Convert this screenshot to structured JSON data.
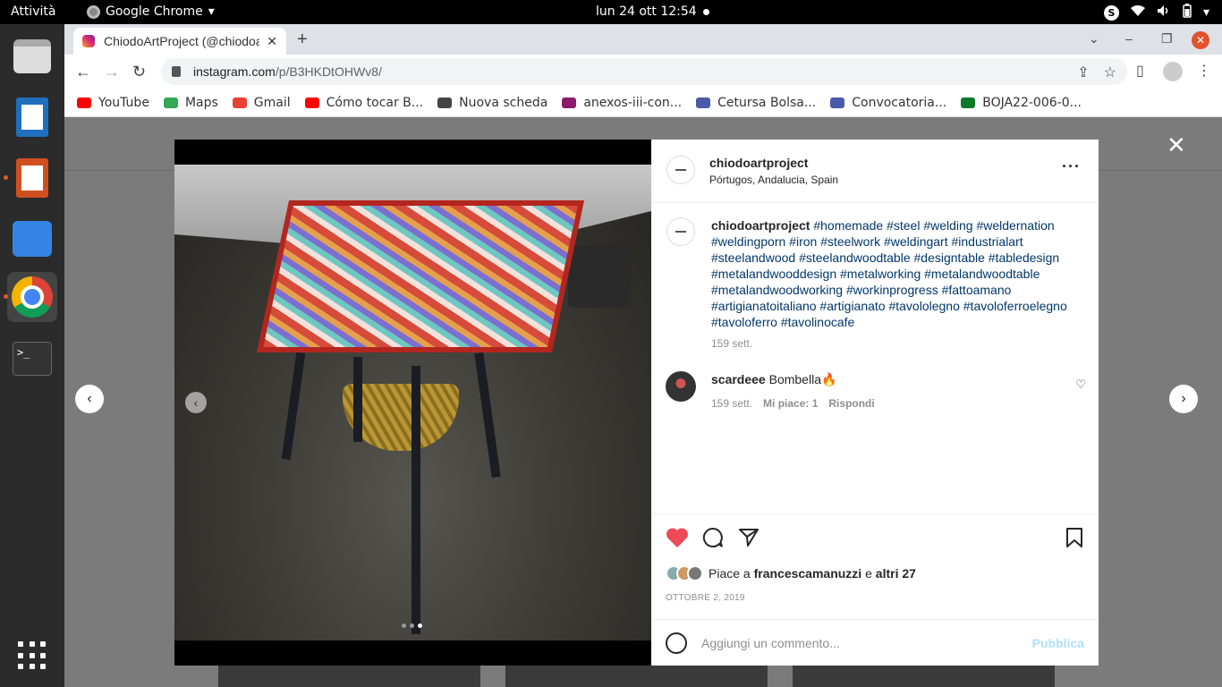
{
  "topbar": {
    "activities": "Attività",
    "app_name": "Google Chrome",
    "clock": "lun 24 ott  12:54"
  },
  "browser": {
    "tab_title": "ChiodoArtProject (@chiodoartproject)",
    "url_host": "instagram.com",
    "url_path": "/p/B3HKDtOHWv8/",
    "bookmarks": [
      {
        "label": "YouTube",
        "color": "#ff0000"
      },
      {
        "label": "Maps",
        "color": "#34a853"
      },
      {
        "label": "Gmail",
        "color": "#ea4335"
      },
      {
        "label": "Cómo tocar B...",
        "color": "#ff0000"
      },
      {
        "label": "Nuova scheda",
        "color": "#444444"
      },
      {
        "label": "anexos-iii-con...",
        "color": "#8b1a6b"
      },
      {
        "label": "Cetursa Bolsa...",
        "color": "#4a5aa8"
      },
      {
        "label": "Convocatoria...",
        "color": "#4a5aa8"
      },
      {
        "label": "BOJA22-006-0...",
        "color": "#0a7a2a"
      }
    ]
  },
  "post": {
    "username": "chiodoartproject",
    "location": "Pórtugos, Andalucia, Spain",
    "caption_user": "chiodoartproject",
    "caption_tags": "#homemade #steel #welding #weldernation #weldingporn #iron #steelwork #weldingart #industrialart #steelandwood #steelandwoodtable #designtable #tabledesign #metalandwooddesign #metalworking #metalandwoodtable #metalandwoodworking #workinprogress #fattoamano #artigianatoitaliano #artigianato #tavololegno #tavoloferroelegno #tavoloferro #tavolinocafe",
    "caption_age": "159 sett.",
    "comment_user": "scardeee",
    "comment_text": "Bombella🔥",
    "comment_age": "159 sett.",
    "comment_likes": "Mi piace: 1",
    "comment_reply": "Rispondi",
    "likes_prefix": "Piace a",
    "likes_user": "francescamanuzzi",
    "likes_join": "e",
    "likes_others": "altri 27",
    "date": "OTTOBRE 2, 2019",
    "comment_placeholder": "Aggiungi un commento...",
    "publish_label": "Pubblica",
    "carousel_total": 3,
    "carousel_active": 3
  },
  "colors": {
    "like_red": "#ed4956",
    "link_blue": "#00376b",
    "publish_disabled": "#b2dffc"
  }
}
